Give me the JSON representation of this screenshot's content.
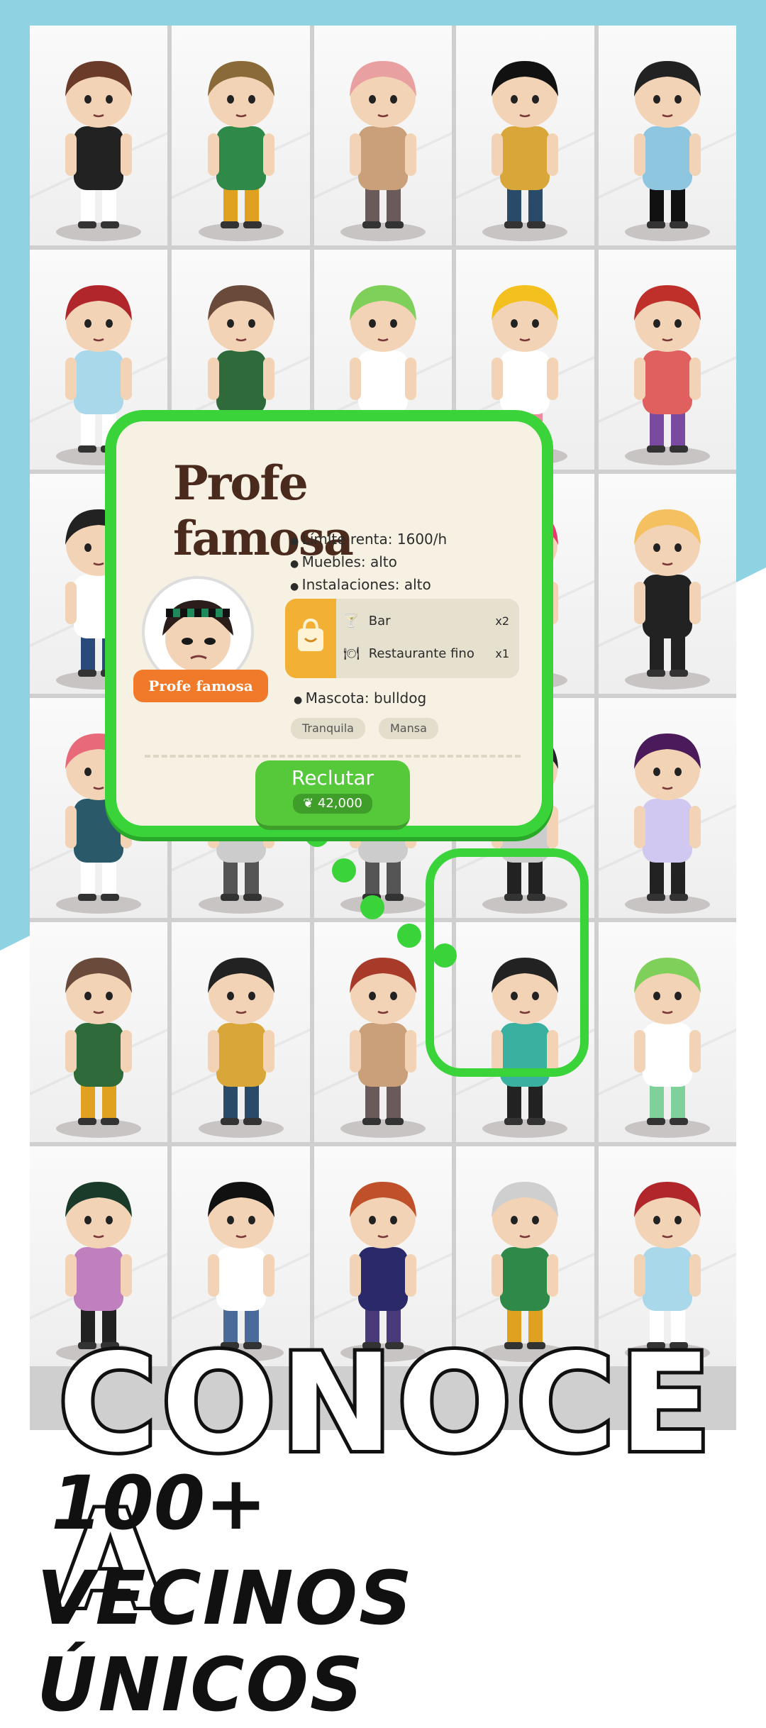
{
  "colors": {
    "accent_green": "#3ad43a",
    "background_blue": "#8fd3e2",
    "card_bg": "#f6f1e3",
    "name_badge": "#f07a2a",
    "recruit_button": "#55c93a",
    "facility_icon": "#f2b134"
  },
  "card": {
    "title": "Profe famosa",
    "stats": [
      "Límite renta: 1600/h",
      "Muebles: alto",
      "Instalaciones: alto"
    ],
    "facilities": [
      {
        "icon": "cocktail-icon",
        "label": "Bar",
        "multiplier": "x2"
      },
      {
        "icon": "dish-icon",
        "label": "Restaurante fino",
        "multiplier": "x1"
      }
    ],
    "facility_icon": "bag-icon",
    "avatar_name": "Profe famosa",
    "pet": "Mascota: bulldog",
    "tags": [
      "Tranquila",
      "Mansa"
    ],
    "recruit_label": "Reclutar",
    "recruit_price": "42,000",
    "currency_icon": "leaf-coin-icon"
  },
  "promo": {
    "headline": "CONOCE A",
    "count": "100+",
    "subline": "VECINOS ÚNICOS"
  },
  "characters": [
    {
      "hair": "#6b3b2a",
      "shirt": "#222222",
      "pants": "#ffffff"
    },
    {
      "hair": "#8b6a3a",
      "shirt": "#2f8a4a",
      "pants": "#e0a020"
    },
    {
      "hair": "#e8a0a0",
      "shirt": "#c9a07a",
      "pants": "#6a5a5a"
    },
    {
      "hair": "#111111",
      "shirt": "#d9a63a",
      "pants": "#2a4a6a"
    },
    {
      "hair": "#222222",
      "shirt": "#8ec6e0",
      "pants": "#111111"
    },
    {
      "hair": "#b0262a",
      "shirt": "#a8d8ea",
      "pants": "#ffffff"
    },
    {
      "hair": "#6a4a3a",
      "shirt": "#2f6a3a",
      "pants": "#2f6a3a"
    },
    {
      "hair": "#7fd05a",
      "shirt": "#ffffff",
      "pants": "#7fd09a"
    },
    {
      "hair": "#f4c020",
      "shirt": "#ffffff",
      "pants": "#f08aa0"
    },
    {
      "hair": "#c0302a",
      "shirt": "#e06060",
      "pants": "#7a4aa0"
    },
    {
      "hair": "#222222",
      "shirt": "#ffffff",
      "pants": "#2a4a7a"
    },
    {
      "hair": "#7ad0e0",
      "shirt": "#9aa0a0",
      "pants": "#555555"
    },
    {
      "hair": "#e86a3a",
      "shirt": "#f0a040",
      "pants": "#555555"
    },
    {
      "hair": "#e83a6a",
      "shirt": "#3a8a6a",
      "pants": "#222222"
    },
    {
      "hair": "#f4c060",
      "shirt": "#222222",
      "pants": "#222222"
    },
    {
      "hair": "#e86a7a",
      "shirt": "#2a5a6a",
      "pants": "#ffffff"
    },
    {
      "hair": "#aaaaaa",
      "shirt": "#cccccc",
      "pants": "#555555"
    },
    {
      "hair": "#aaaaaa",
      "shirt": "#cccccc",
      "pants": "#555555"
    },
    {
      "hair": "#222222",
      "shirt": "#cccccc",
      "pants": "#222222"
    },
    {
      "hair": "#4a1a5a",
      "shirt": "#d0c8f0",
      "pants": "#222222"
    },
    {
      "hair": "#6a4a3a",
      "shirt": "#2f6a3a",
      "pants": "#e0a020"
    },
    {
      "hair": "#222222",
      "shirt": "#d9a63a",
      "pants": "#2a4a6a"
    },
    {
      "hair": "#a83a2a",
      "shirt": "#c9a07a",
      "pants": "#6a5a5a"
    },
    {
      "hair": "#222222",
      "shirt": "#3ab0a0",
      "pants": "#222222"
    },
    {
      "hair": "#7fd05a",
      "shirt": "#ffffff",
      "pants": "#7fd09a"
    },
    {
      "hair": "#1a3a2a",
      "shirt": "#c080c0",
      "pants": "#222222"
    },
    {
      "hair": "#111111",
      "shirt": "#ffffff",
      "pants": "#4a6a9a"
    },
    {
      "hair": "#c0502a",
      "shirt": "#2a2a6a",
      "pants": "#4a3a7a"
    },
    {
      "hair": "#cfcfcf",
      "shirt": "#2f8a4a",
      "pants": "#e0a020"
    },
    {
      "hair": "#b0262a",
      "shirt": "#a8d8ea",
      "pants": "#ffffff"
    }
  ]
}
